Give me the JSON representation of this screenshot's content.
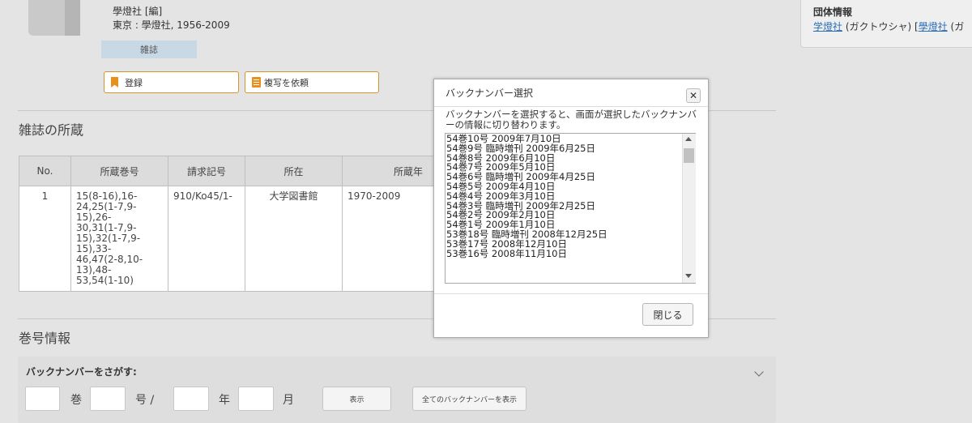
{
  "record": {
    "publisher_line": "學燈社 [編]",
    "imprint": "東京 : 學燈社, 1956-2009",
    "type_badge": "雑誌"
  },
  "actions": {
    "register_label": "登録",
    "copy_request_label": "複写を依頼"
  },
  "holdings": {
    "section_title": "雑誌の所蔵",
    "columns": [
      "No.",
      "所蔵巻号",
      "請求記号",
      "所在",
      "所蔵年"
    ],
    "rows": [
      {
        "no": "1",
        "volumes": "15(8-16),16-\n24,25(1-7,9-\n15),26-\n30,31(1-7,9-\n15),32(1-7,9-\n15),33-\n46,47(2-8,10-\n13),48-\n53,54(1-10)",
        "call_number": "910/Ko45/1-",
        "location": "大学図書館",
        "years": "1970-2009"
      }
    ]
  },
  "org_info": {
    "title": "団体情報",
    "link1": "学燈社",
    "reading": " (ガクトウシャ) [",
    "link2": "學燈社",
    "tail": " (ガ"
  },
  "volume_info": {
    "section_title": "巻号情報",
    "search_label": "バックナンバーをさがす:",
    "vol_label": "巻",
    "num_label": "号 /",
    "year_label": "年",
    "month_label": "月",
    "show_button": "表示",
    "show_all_button": "全てのバックナンバーを表示"
  },
  "modal": {
    "title": "バックナンバー選択",
    "close_icon": "close-icon",
    "description": "バックナンバーを選択すると、画面が選択したバックナンバーの情報に切り替わります。",
    "items": [
      "54巻10号 2009年7月10日",
      "54巻9号 臨時増刊 2009年6月25日",
      "54巻8号 2009年6月10日",
      "54巻7号 2009年5月10日",
      "54巻6号 臨時増刊 2009年4月25日",
      "54巻5号 2009年4月10日",
      "54巻4号 2009年3月10日",
      "54巻3号 臨時増刊 2009年2月25日",
      "54巻2号 2009年2月10日",
      "54巻1号 2009年1月10日",
      "53巻18号 臨時増刊 2008年12月25日",
      "53巻17号 2008年12月10日",
      "53巻16号 2008年11月10日"
    ],
    "close_button": "閉じる"
  },
  "colors": {
    "accent_orange": "#e8901e",
    "link_blue": "#2a6ebb",
    "badge_bg": "#c8d8e4"
  }
}
